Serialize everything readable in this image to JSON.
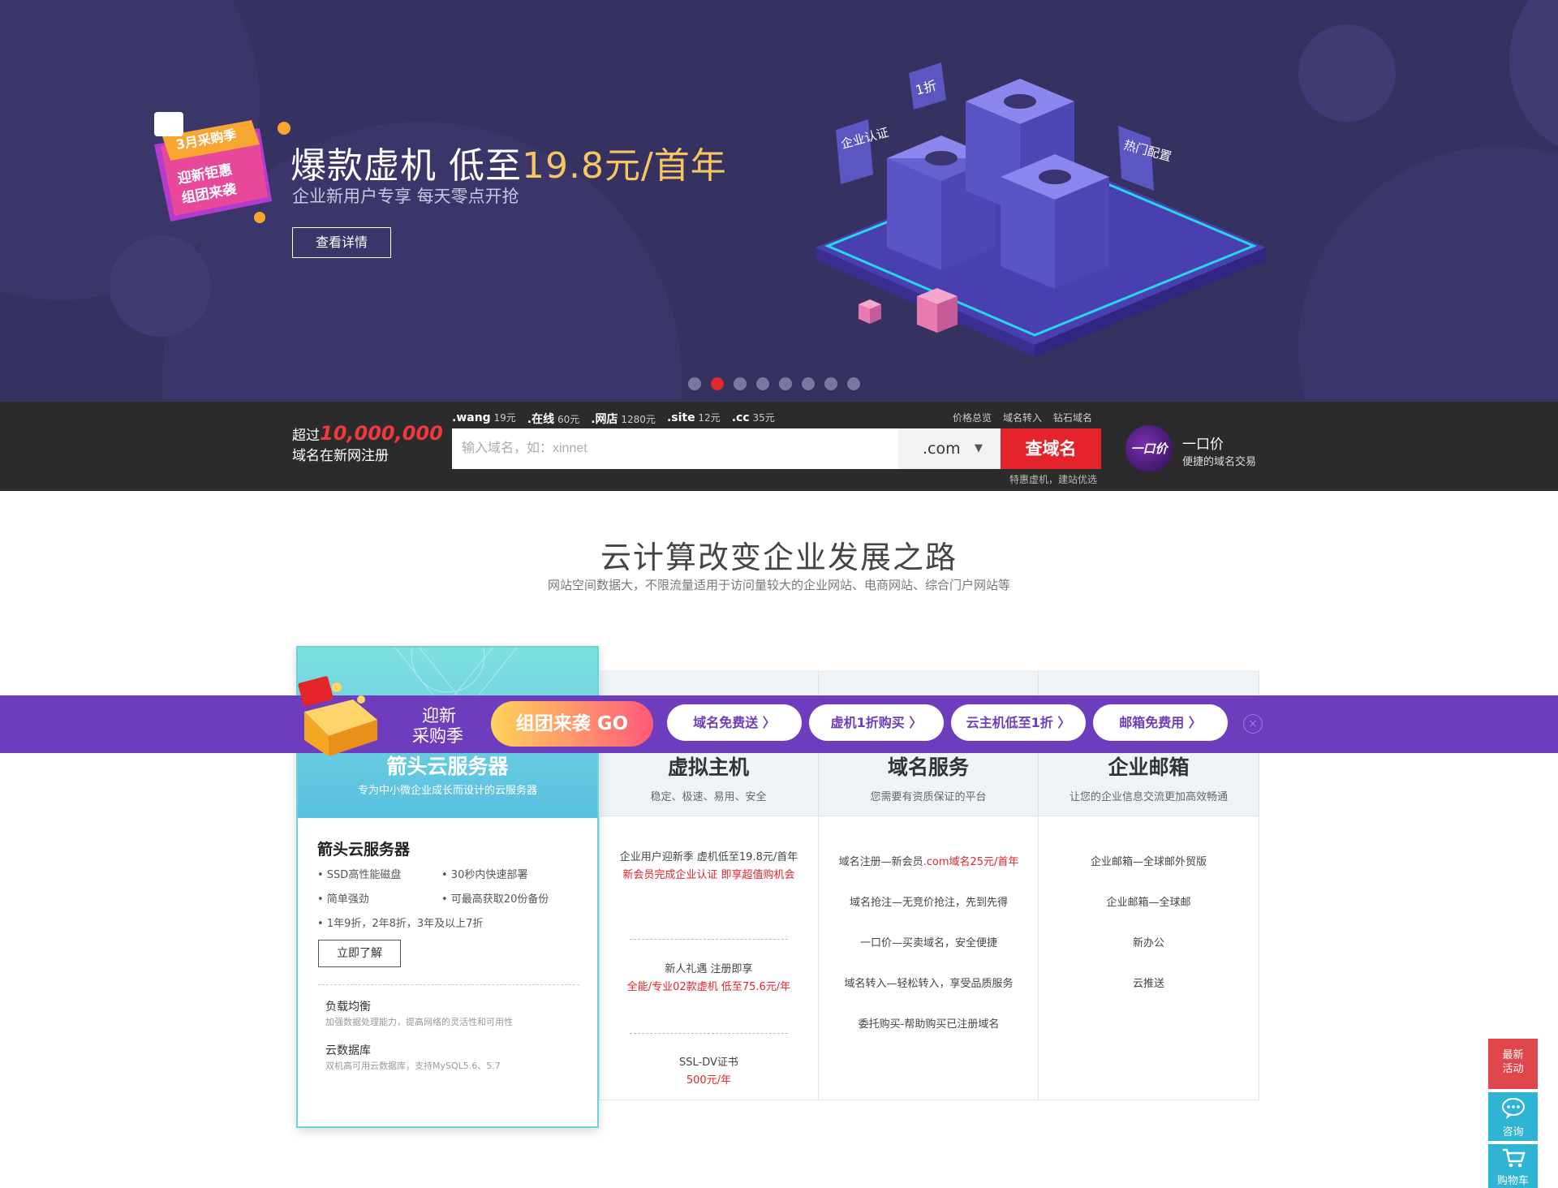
{
  "hero": {
    "badge_line1": "3月采购季",
    "badge_line2": "迎新钜惠",
    "badge_line3": "组团来袭",
    "title_main": "爆款虚机 低至",
    "title_price": "19.8元/首年",
    "subtitle": "企业新用户专享 每天零点开抢",
    "button": "查看详情",
    "tag_left": "企业认证",
    "tag_top": "1折",
    "tag_right": "热门配置",
    "active_slide": 2,
    "slide_count": 8
  },
  "domain_bar": {
    "count_prefix": "超过",
    "count_number": "10,000,000",
    "count_suffix": "域名在新网注册",
    "tld_prices": [
      {
        "tld": ".wang",
        "price": "19元"
      },
      {
        "tld": ".在线",
        "price": "60元"
      },
      {
        "tld": ".网店",
        "price": "1280元"
      },
      {
        "tld": ".site",
        "price": "12元"
      },
      {
        "tld": ".cc",
        "price": "35元"
      }
    ],
    "links": [
      "价格总览",
      "域名转入",
      "钻石域名"
    ],
    "input_placeholder": "输入域名，如：xinnet",
    "tld_selected": ".com",
    "search_button": "查域名",
    "note": "特惠虚机，建站优选",
    "yikou_avatar": "一口价",
    "yikou_title": "一口价",
    "yikou_sub": "便捷的域名交易"
  },
  "section": {
    "title": "云计算改变企业发展之路",
    "subtitle": "网站空间数据大，不限流量适用于访问量较大的企业网站、电商网站、综合门户网站等"
  },
  "featured": {
    "title": "箭头云服务器",
    "subtitle": "专为中小微企业成长而设计的云服务器",
    "name": "箭头云服务器",
    "bullets": [
      "• SSD高性能磁盘",
      "• 30秒内快速部署",
      "• 简单强劲",
      "• 可最高获取20份备份"
    ],
    "promo": "• 1年9折，2年8折，3年及以上7折",
    "button": "立即了解",
    "sub_items": [
      {
        "title": "负载均衡",
        "desc": "加强数据处理能力，提高网络的灵活性和可用性"
      },
      {
        "title": "云数据库",
        "desc": "双机高可用云数据库，支持MySQL5.6、5.7"
      }
    ]
  },
  "columns": [
    {
      "title": "虚拟主机",
      "subtitle": "稳定、极速、易用、安全",
      "items": [
        {
          "line1": "企业用户迎新季 虚机低至19.8元/首年",
          "red": "新会员完成企业认证 即享超值购机会"
        },
        {
          "line1": "新人礼遇 注册即享",
          "red": "全能/专业02款虚机 低至75.6元/年"
        },
        {
          "line1": "SSL-DV证书",
          "red": "500元/年"
        }
      ]
    },
    {
      "title": "域名服务",
      "subtitle": "您需要有资质保证的平台",
      "items": [
        {
          "pre": "域名注册—新会员",
          "red": ".com域名25元/首年"
        },
        {
          "pre": "域名抢注—无竞价抢注，先到先得"
        },
        {
          "pre": "一口价—买卖域名，安全便捷"
        },
        {
          "pre": "域名转入—轻松转入，享受品质服务"
        },
        {
          "pre": "委托购买-帮助购买已注册域名"
        }
      ]
    },
    {
      "title": "企业邮箱",
      "subtitle": "让您的企业信息交流更加高效畅通",
      "items": [
        "企业邮箱—全球邮外贸版",
        "企业邮箱—全球邮",
        "新办公",
        "云推送"
      ]
    }
  ],
  "banner": {
    "line1": "迎新",
    "line2": "采购季",
    "go": "组团来袭 GO",
    "pills": [
      "域名免费送 〉",
      "虚机1折购买 〉",
      "云主机低至1折 〉",
      "邮箱免费用 〉"
    ],
    "close": "×"
  },
  "side": {
    "activity": "最新活动",
    "consult": "咨询",
    "cart": "购物车"
  },
  "colors": {
    "hero_bg": "#353161",
    "accent_red": "#e5232a",
    "banner_purple": "#6e3dbd",
    "price_gold": "#f7c660"
  }
}
